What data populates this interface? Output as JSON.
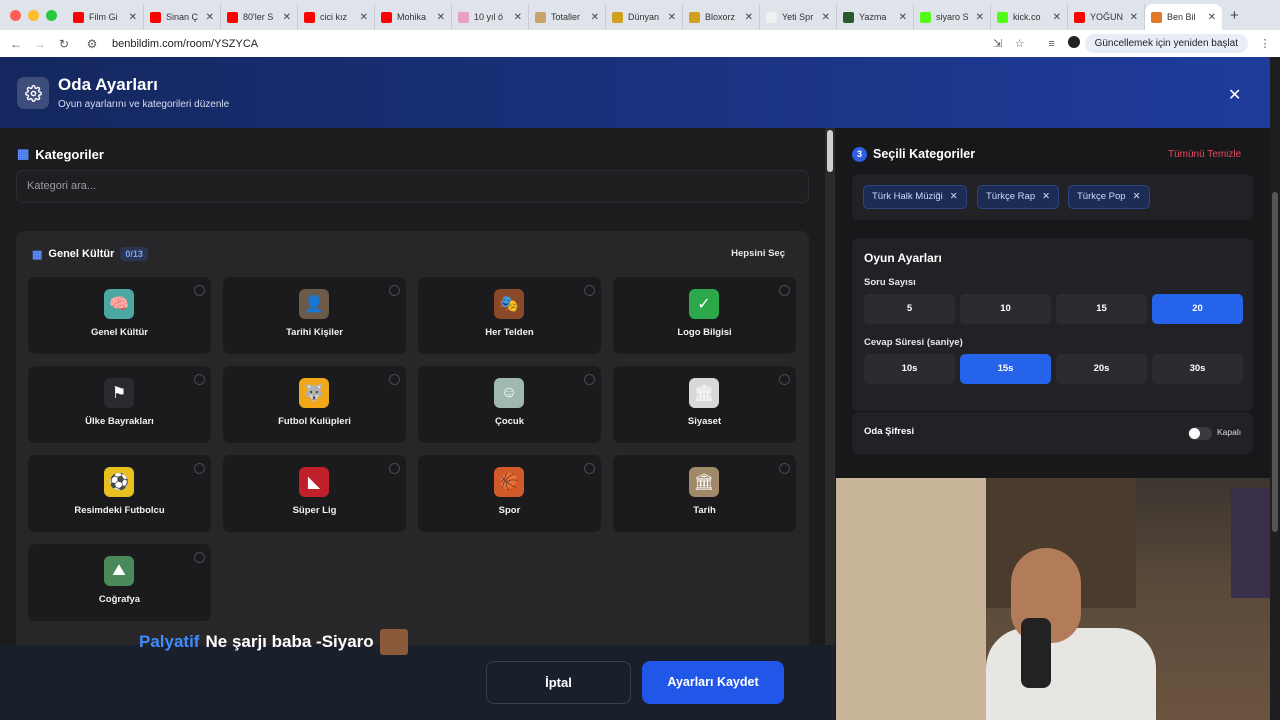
{
  "browser": {
    "tabs": [
      {
        "title": "Film Gi",
        "color": "#ff0000"
      },
      {
        "title": "Sinan Ç",
        "color": "#ff0000"
      },
      {
        "title": "80'ler S",
        "color": "#ff0000"
      },
      {
        "title": "cici kız",
        "color": "#ff0000"
      },
      {
        "title": "Mohika",
        "color": "#ff0000"
      },
      {
        "title": "10 yıl ö",
        "color": "#e8a0c0"
      },
      {
        "title": "Totaller",
        "color": "#c9a46a"
      },
      {
        "title": "Dünyan",
        "color": "#d2a020"
      },
      {
        "title": "Bloxorz",
        "color": "#d2a020"
      },
      {
        "title": "Yeti Spr",
        "color": "#f0f0f0"
      },
      {
        "title": "Yazma",
        "color": "#2a5a2a"
      },
      {
        "title": "siyaro S",
        "color": "#53fc18"
      },
      {
        "title": "kick.co",
        "color": "#53fc18"
      },
      {
        "title": "YOĞUN",
        "color": "#ff0000"
      },
      {
        "title": "Ben Bil",
        "color": "#e07a2a"
      }
    ],
    "new_tab": "+",
    "url": "benbildim.com/room/YSZYCA",
    "update_button": "Güncellemek için yeniden başlat"
  },
  "header": {
    "title": "Oda Ayarları",
    "subtitle": "Oyun ayarlarını ve kategorileri düzenle",
    "close": "✕"
  },
  "categories": {
    "section_title": "Kategoriler",
    "search_placeholder": "Kategori ara...",
    "group": {
      "title": "Genel Kültür",
      "count": "0/13",
      "select_all": "Hepsini Seç",
      "items": [
        {
          "label": "Genel Kültür",
          "icon": "brain-icon",
          "glyph": "🧠",
          "bg": "#4aa8a0"
        },
        {
          "label": "Tarihi Kişiler",
          "icon": "portrait-icon",
          "glyph": "👤",
          "bg": "#6b5a4a"
        },
        {
          "label": "Her Telden",
          "icon": "mixed-icon",
          "glyph": "🎭",
          "bg": "#8a4a2a"
        },
        {
          "label": "Logo Bilgisi",
          "icon": "logo-icon",
          "glyph": "✓",
          "bg": "#2aa84a"
        },
        {
          "label": "Ülke Bayrakları",
          "icon": "flag-icon",
          "glyph": "⚑",
          "bg": "#2a2a30"
        },
        {
          "label": "Futbol Kulüpleri",
          "icon": "wolf-crest-icon",
          "glyph": "🐺",
          "bg": "#f0a81a"
        },
        {
          "label": "Çocuk",
          "icon": "child-icon",
          "glyph": "☺",
          "bg": "#a0b8b0"
        },
        {
          "label": "Siyaset",
          "icon": "parliament-icon",
          "glyph": "🏛",
          "bg": "#d8d8d8"
        },
        {
          "label": "Resimdeki Futbolcu",
          "icon": "footballer-icon",
          "glyph": "⚽",
          "bg": "#e8c020"
        },
        {
          "label": "Süper Lig",
          "icon": "league-icon",
          "glyph": "◣",
          "bg": "#c0202a"
        },
        {
          "label": "Spor",
          "icon": "sports-balls-icon",
          "glyph": "🏀",
          "bg": "#d05a2a"
        },
        {
          "label": "Tarih",
          "icon": "colosseum-icon",
          "glyph": "🏛",
          "bg": "#a08a6a"
        },
        {
          "label": "Coğrafya",
          "icon": "mountain-icon",
          "glyph": "⛰",
          "bg": "#4a8a5a"
        }
      ]
    }
  },
  "selected": {
    "count": "3",
    "title": "Seçili Kategoriler",
    "clear_all": "Tümünü Temizle",
    "chips": [
      "Türk Halk Müziği",
      "Türkçe Rap",
      "Türkçe Pop"
    ]
  },
  "game_settings": {
    "title": "Oyun Ayarları",
    "question_count_label": "Soru Sayısı",
    "question_counts": [
      "5",
      "10",
      "15",
      "20"
    ],
    "question_count_selected": "20",
    "answer_time_label": "Cevap Süresi (saniye)",
    "answer_times": [
      "10s",
      "15s",
      "20s",
      "30s"
    ],
    "answer_time_selected": "15s"
  },
  "room_password": {
    "label": "Oda Şifresi",
    "state": "Kapalı"
  },
  "overlay": {
    "user": "Palyatif",
    "message": "Ne şarjı baba -Siyaro"
  },
  "footer": {
    "cancel": "İptal",
    "save": "Ayarları Kaydet"
  }
}
